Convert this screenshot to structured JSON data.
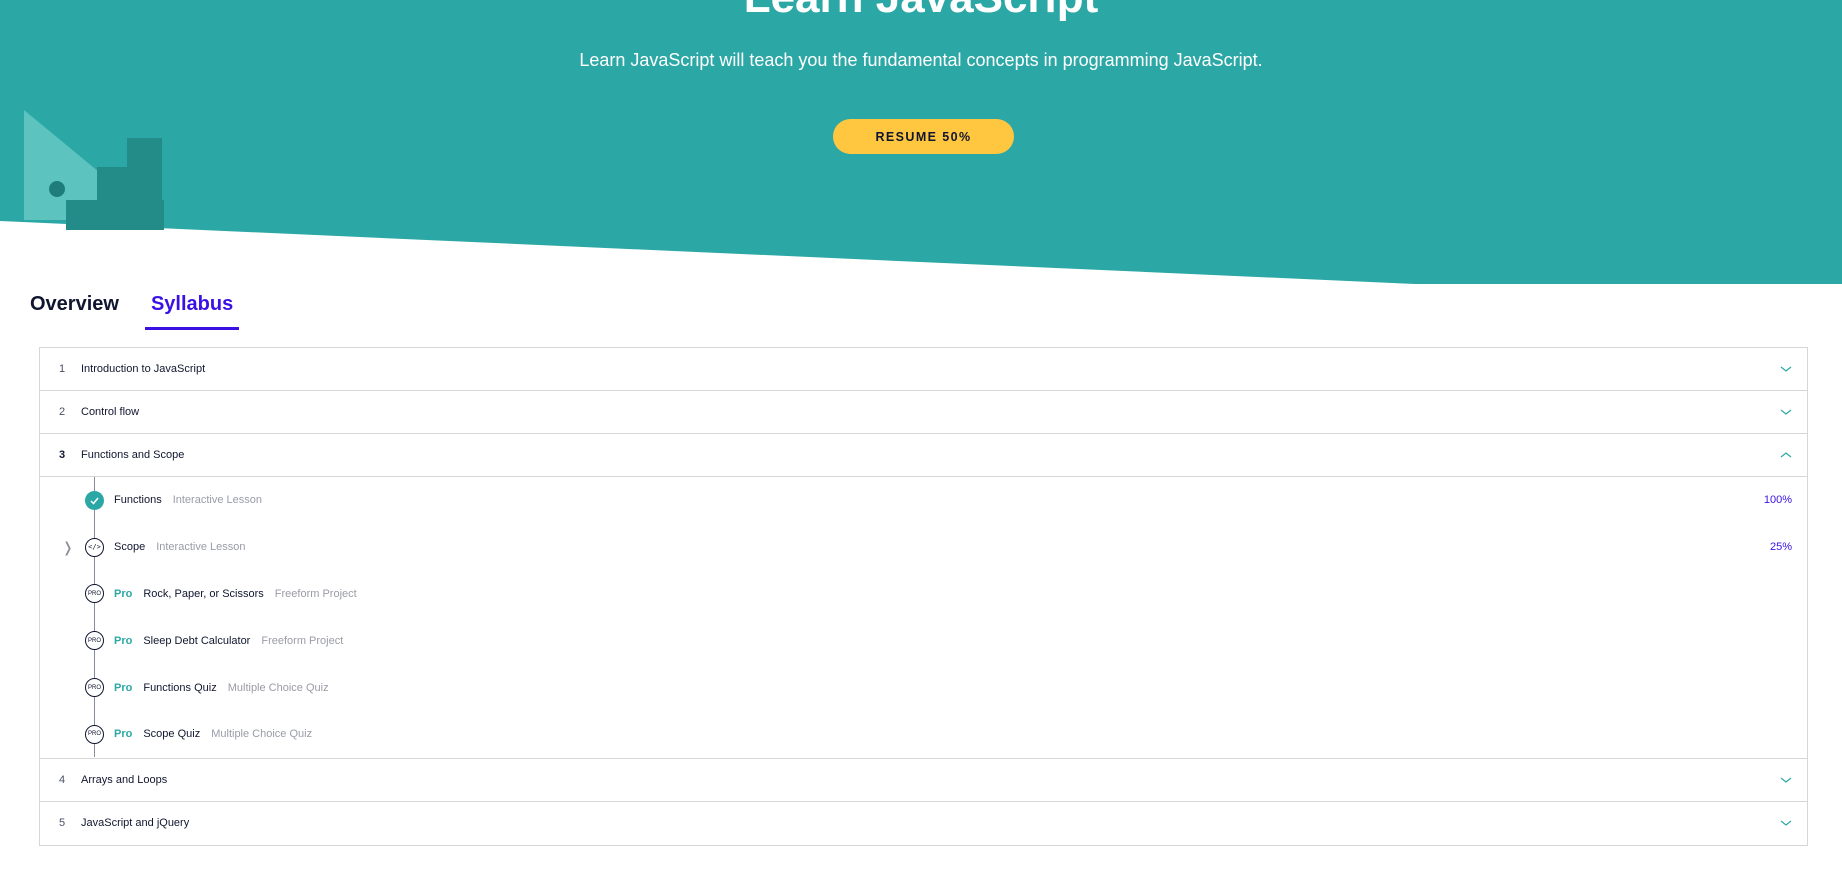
{
  "hero": {
    "title": "Learn JavaScript",
    "subtitle": "Learn JavaScript will teach you the fundamental concepts in programming JavaScript.",
    "resume_label": "RESUME 50%",
    "colors": {
      "background": "#2ba8a5",
      "button": "#ffc740"
    }
  },
  "tabs": [
    {
      "label": "Overview",
      "active": false
    },
    {
      "label": "Syllabus",
      "active": true
    }
  ],
  "syllabus": {
    "modules": [
      {
        "number": "1",
        "title": "Introduction to JavaScript",
        "expanded": false
      },
      {
        "number": "2",
        "title": "Control flow",
        "expanded": false
      },
      {
        "number": "3",
        "title": "Functions and Scope",
        "expanded": true,
        "lessons": [
          {
            "status": "complete",
            "icon": "check-icon",
            "pro": "",
            "name": "Functions",
            "type": "Interactive Lesson",
            "progress": "100%"
          },
          {
            "status": "in-progress",
            "icon": "code-icon",
            "pro": "",
            "name": "Scope",
            "type": "Interactive Lesson",
            "progress": "25%"
          },
          {
            "status": "locked",
            "icon": "pro-icon",
            "pro": "Pro",
            "name": "Rock, Paper, or Scissors",
            "type": "Freeform Project",
            "progress": ""
          },
          {
            "status": "locked",
            "icon": "pro-icon",
            "pro": "Pro",
            "name": "Sleep Debt Calculator",
            "type": "Freeform Project",
            "progress": ""
          },
          {
            "status": "locked",
            "icon": "pro-icon",
            "pro": "Pro",
            "name": "Functions Quiz",
            "type": "Multiple Choice Quiz",
            "progress": ""
          },
          {
            "status": "locked",
            "icon": "pro-icon",
            "pro": "Pro",
            "name": "Scope Quiz",
            "type": "Multiple Choice Quiz",
            "progress": ""
          }
        ]
      },
      {
        "number": "4",
        "title": "Arrays and Loops",
        "expanded": false
      },
      {
        "number": "5",
        "title": "JavaScript and jQuery",
        "expanded": false
      }
    ],
    "icon_labels": {
      "code": "</>",
      "pro": "PRO"
    },
    "colors": {
      "accent": "#3a10e5",
      "teal": "#2ba8a5"
    }
  }
}
